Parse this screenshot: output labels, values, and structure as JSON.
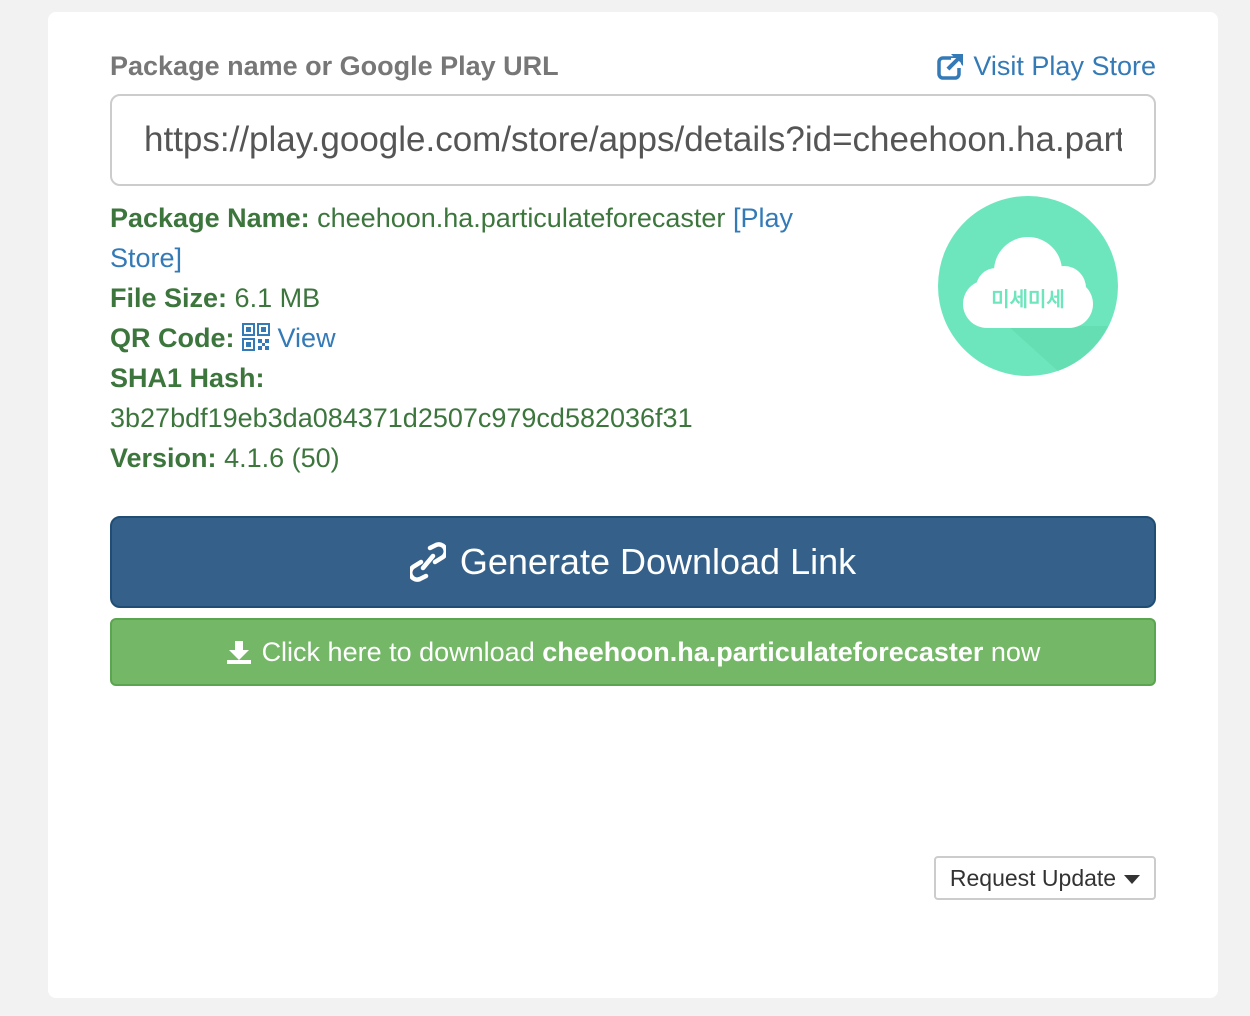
{
  "form": {
    "label": "Package name or Google Play URL",
    "visit_store": "Visit Play Store",
    "url_value": "https://play.google.com/store/apps/details?id=cheehoon.ha.particulateforecaster"
  },
  "details": {
    "package_name_label": "Package Name:",
    "package_name": "cheehoon.ha.particulateforecaster",
    "play_store_link": "[Play Store]",
    "file_size_label": "File Size:",
    "file_size": "6.1 MB",
    "qr_label": "QR Code:",
    "qr_view": "View",
    "sha1_label": "SHA1 Hash:",
    "sha1": "3b27bdf19eb3da084371d2507c979cd582036f31",
    "version_label": "Version:",
    "version": "4.1.6 (50)"
  },
  "app_icon": {
    "text": "미세미세",
    "color": "#6ee6bd",
    "icon": "cloud-icon"
  },
  "actions": {
    "generate_label": "Generate Download Link",
    "download_prefix": "Click here to download",
    "download_package": "cheehoon.ha.particulateforecaster",
    "download_suffix": "now",
    "request_update": "Request Update"
  },
  "colors": {
    "primary": "#356089",
    "success": "#74b767",
    "link": "#337ab7",
    "info_text": "#3c763d"
  }
}
